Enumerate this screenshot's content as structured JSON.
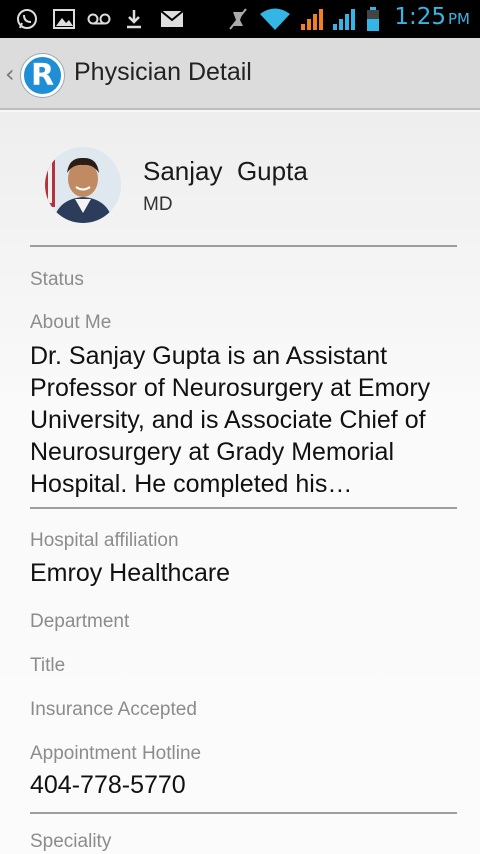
{
  "status_bar": {
    "time": "1:25",
    "ampm": "PM",
    "icons": [
      "whatsapp-icon",
      "image-icon",
      "voicemail-icon",
      "download-icon",
      "mail-icon",
      "mute-icon",
      "wifi-icon",
      "signal-icon",
      "signal-icon",
      "battery-icon"
    ],
    "accent_color": "#33b5e5"
  },
  "action_bar": {
    "back": "‹",
    "logo_letter": "R",
    "title": "Physician Detail"
  },
  "physician": {
    "first_name": "Sanjay",
    "last_name": "Gupta",
    "full_name": "Sanjay  Gupta",
    "credential": "MD"
  },
  "fields": {
    "status_label": "Status",
    "about_label": "About Me",
    "about_text": "Dr. Sanjay Gupta is an Assistant Professor of Neurosurgery at Emory University, and is Associate Chief of Neurosurgery at Grady Memorial Hospital. He completed his…",
    "hospital_label": "Hospital affiliation",
    "hospital_value": "Emroy Healthcare",
    "department_label": "Department",
    "title_label": "Title",
    "insurance_label": "Insurance Accepted",
    "hotline_label": "Appointment Hotline",
    "hotline_value": "404-778-5770",
    "specialty_label_partial": "Speciality"
  }
}
